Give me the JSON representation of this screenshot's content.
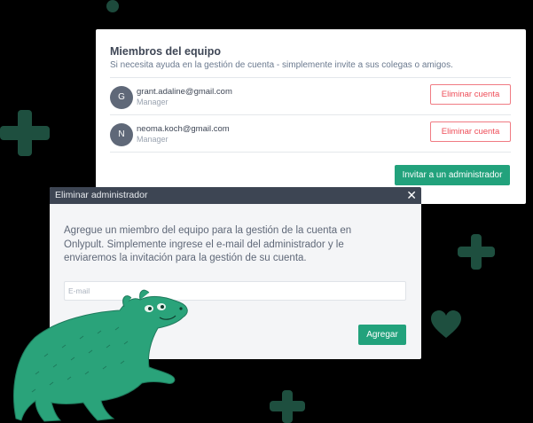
{
  "team_card": {
    "title": "Miembros del equipo",
    "subtitle": "Si necesita ayuda en la gestión de cuenta - simplemente invite a sus colegas o amigos.",
    "members": [
      {
        "initial": "G",
        "email": "grant.adaline@gmail.com",
        "role": "Manager",
        "remove_label": "Eliminar cuenta"
      },
      {
        "initial": "N",
        "email": "neoma.koch@gmail.com",
        "role": "Manager",
        "remove_label": "Eliminar cuenta"
      }
    ],
    "invite_label": "Invitar a un administrador"
  },
  "modal": {
    "title": "Eliminar administrador",
    "close_icon": "close-icon",
    "description": "Agregue un miembro del equipo para la gestión de la cuenta en Onlypult. Simplemente ingrese el e-mail del administrador y le enviaremos la invitación para la gestión de su cuenta.",
    "email_placeholder": "E-mail",
    "email_value": "",
    "add_label": "Agregar"
  },
  "colors": {
    "accent": "#22a27c",
    "danger": "#ee4c57",
    "header": "#3d4553",
    "decoration": "#1e4f3f"
  },
  "icons": [
    "plus-decoration-icon",
    "heart-decoration-icon",
    "dot-decoration-icon",
    "capybara-mascot-icon"
  ]
}
